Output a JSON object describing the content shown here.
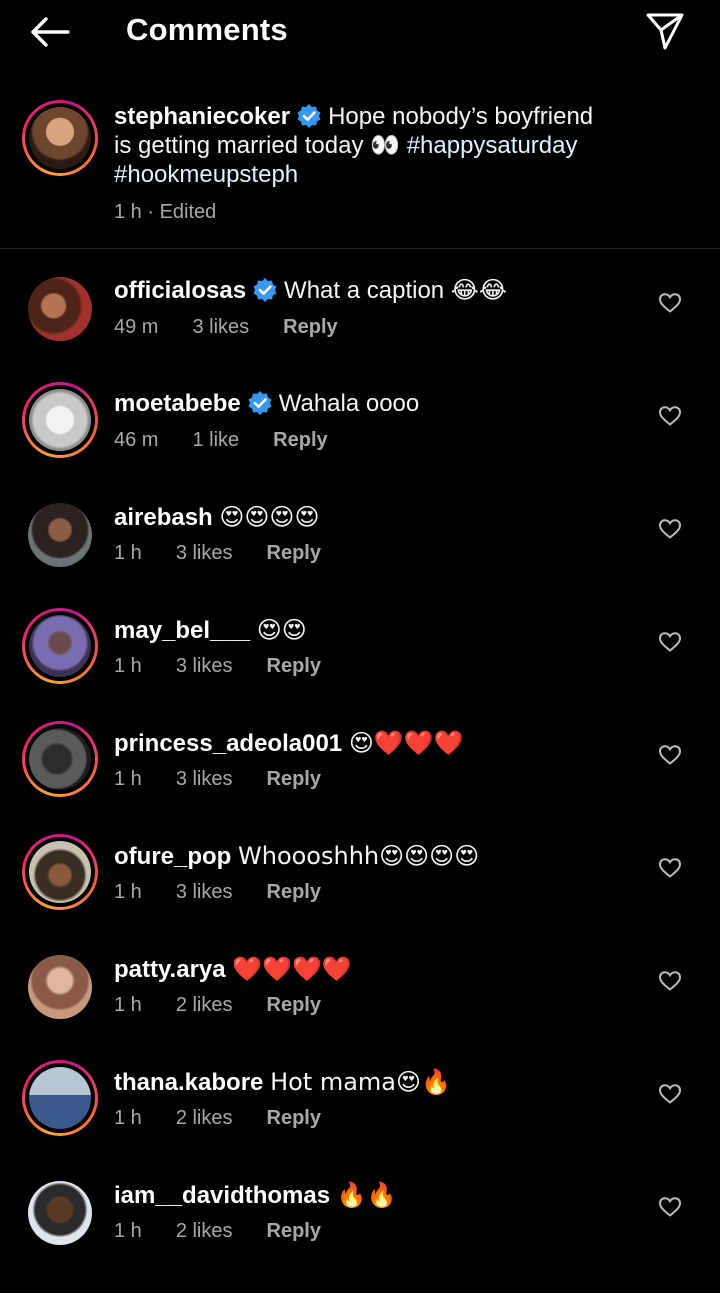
{
  "header": {
    "title": "Comments",
    "back_icon": "arrow-left-icon",
    "send_icon": "paper-plane-icon"
  },
  "caption": {
    "username": "stephaniecoker",
    "verified": true,
    "text": "Hope nobody’s boyfriend is getting married today 👀",
    "hashtag1": "#happysaturday",
    "hashtag2": "#hookmeupsteph",
    "meta": "1 h · Edited"
  },
  "comments": [
    {
      "username": "officialosas",
      "verified": true,
      "text": "What a caption 😂😂",
      "time": "49 m",
      "likes": "3 likes",
      "reply": "Reply"
    },
    {
      "username": "moetabebe",
      "verified": true,
      "text": "Wahala oooo",
      "time": "46 m",
      "likes": "1 like",
      "reply": "Reply"
    },
    {
      "username": "airebash",
      "verified": false,
      "text": "😍😍😍😍",
      "time": "1 h",
      "likes": "3 likes",
      "reply": "Reply"
    },
    {
      "username": "may_bel___",
      "verified": false,
      "text": "😍😍",
      "time": "1 h",
      "likes": "3 likes",
      "reply": "Reply"
    },
    {
      "username": "princess_adeola001",
      "verified": false,
      "text": "😍❤️❤️❤️",
      "time": "1 h",
      "likes": "3 likes",
      "reply": "Reply"
    },
    {
      "username": "ofure_pop",
      "verified": false,
      "text": "Whoooshhh😍😍😍😍",
      "time": "1 h",
      "likes": "3 likes",
      "reply": "Reply"
    },
    {
      "username": "patty.arya",
      "verified": false,
      "text": "❤️❤️❤️❤️",
      "time": "1 h",
      "likes": "2 likes",
      "reply": "Reply"
    },
    {
      "username": "thana.kabore",
      "verified": false,
      "text": "Hot mama😍🔥",
      "time": "1 h",
      "likes": "2 likes",
      "reply": "Reply"
    },
    {
      "username": "iam__davidthomas",
      "verified": false,
      "text": "🔥🔥",
      "time": "1 h",
      "likes": "2 likes",
      "reply": "Reply"
    }
  ],
  "colors": {
    "background": "#000000",
    "secondary_text": "#a8a8a8",
    "verified_badge": "#3897f0"
  }
}
